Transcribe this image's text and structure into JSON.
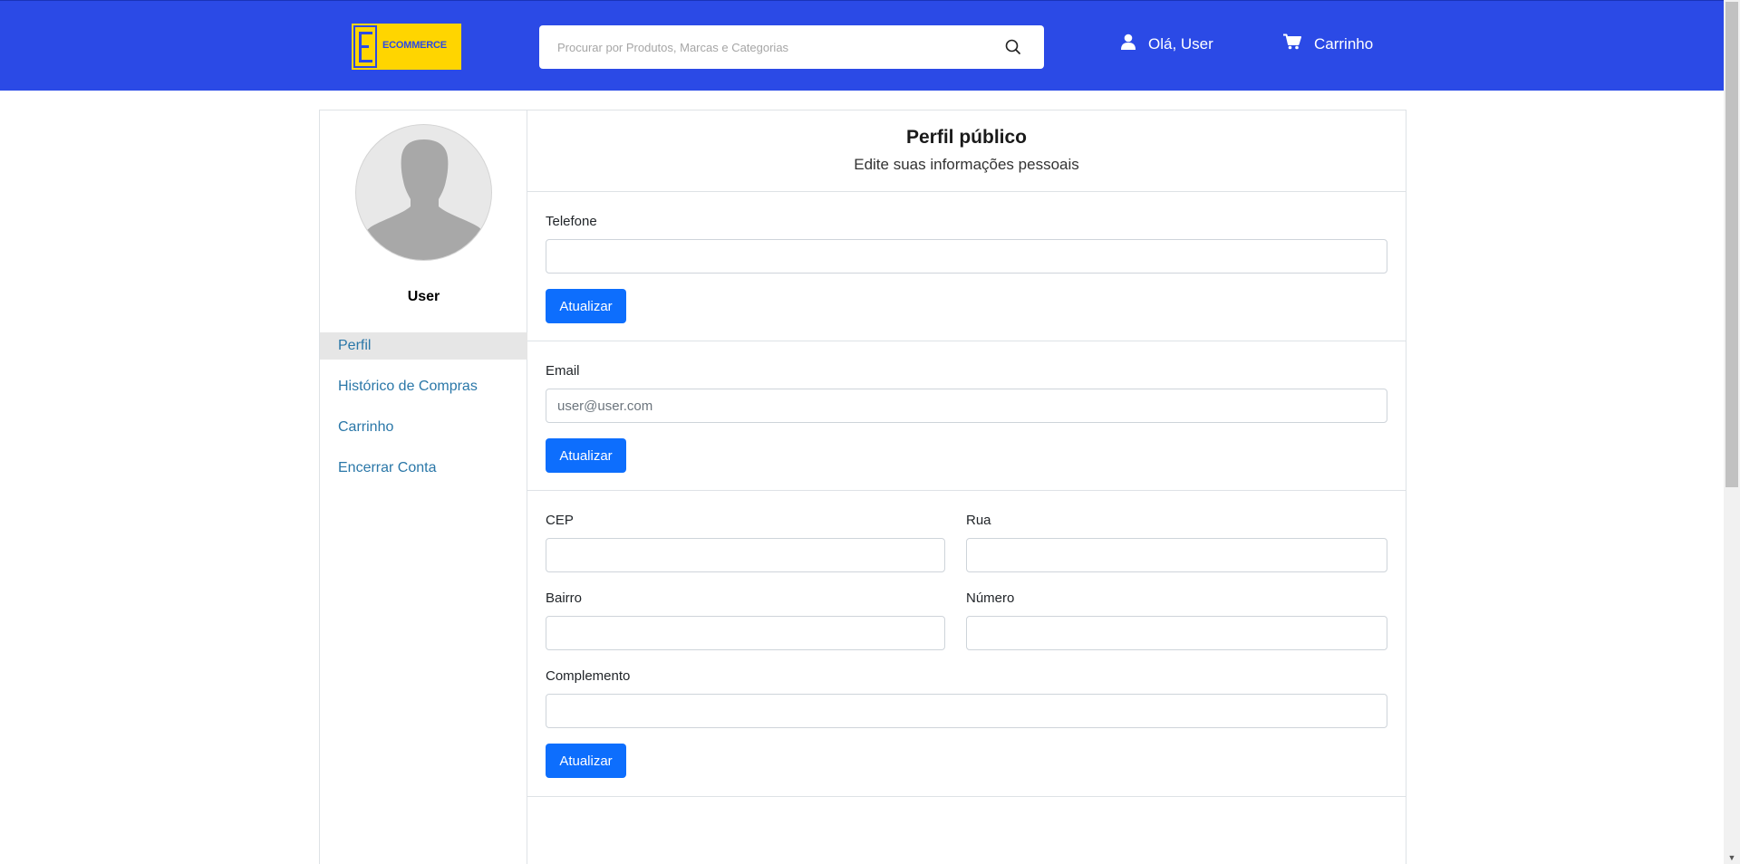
{
  "header": {
    "logo_text": "ECOMMERCE",
    "logo_letter": "E",
    "search_placeholder": "Procurar por Produtos, Marcas e Categorias",
    "user_greeting": "Olá, User",
    "cart_label": "Carrinho",
    "colors": {
      "brand_blue": "#2b4ae6",
      "logo_yellow": "#ffd500"
    }
  },
  "sidebar": {
    "user_name": "User",
    "items": [
      {
        "label": "Perfil",
        "active": true
      },
      {
        "label": "Histórico de Compras",
        "active": false
      },
      {
        "label": "Carrinho",
        "active": false
      },
      {
        "label": "Encerrar Conta",
        "active": false
      }
    ]
  },
  "main": {
    "title": "Perfil público",
    "subtitle": "Edite suas informações pessoais",
    "phone": {
      "label": "Telefone",
      "value": "",
      "button": "Atualizar"
    },
    "email": {
      "label": "Email",
      "placeholder": "user@user.com",
      "button": "Atualizar"
    },
    "address": {
      "cep_label": "CEP",
      "rua_label": "Rua",
      "bairro_label": "Bairro",
      "numero_label": "Número",
      "complemento_label": "Complemento",
      "button": "Atualizar"
    }
  }
}
